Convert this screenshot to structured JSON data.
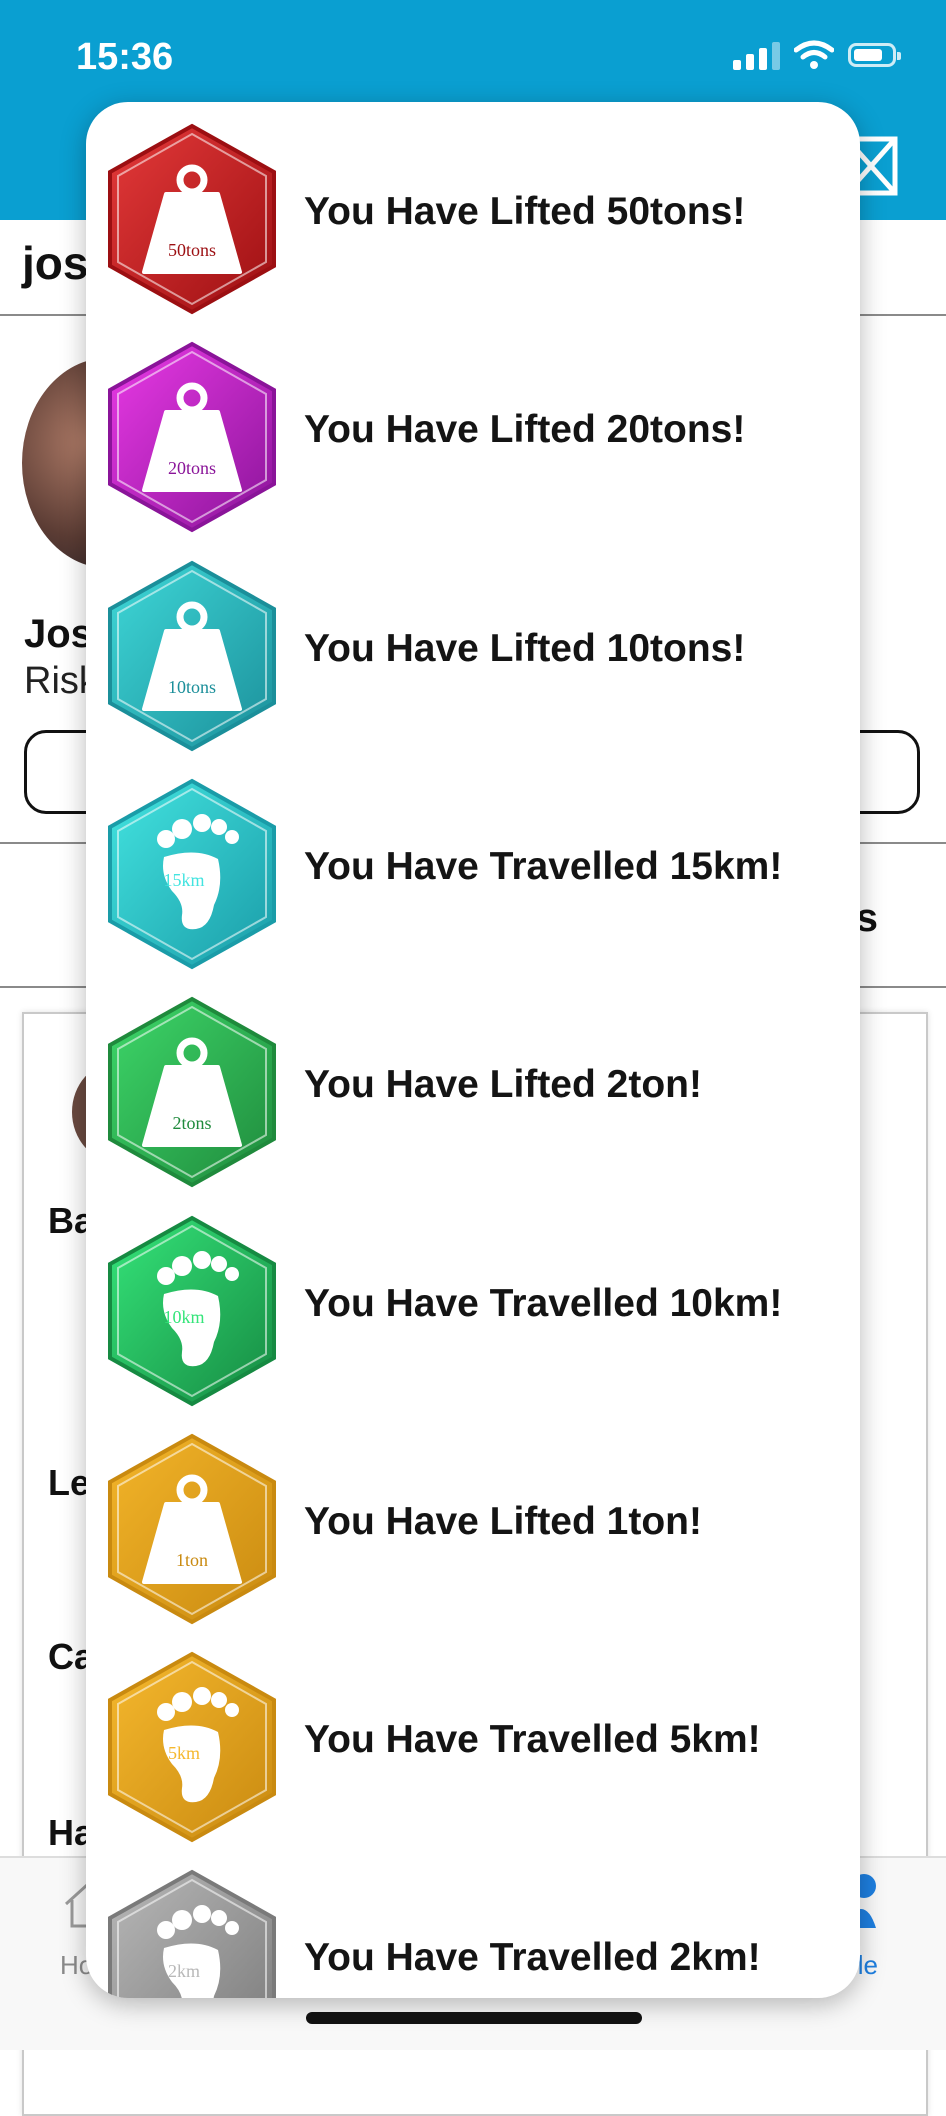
{
  "status_bar": {
    "time": "15:36"
  },
  "profile": {
    "username_fragment": "jos",
    "name_fragment": "Jos",
    "subtitle_fragment": "Risk",
    "tab_fragment": "s",
    "card_labels": [
      "Ba",
      "Le",
      "Ca",
      "Ha"
    ]
  },
  "tab_bar": {
    "home_label_fragment": "Ho",
    "profile_label_fragment": "ile",
    "active_color": "#1e7fe0"
  },
  "colors": {
    "header": "#0a9fd1"
  },
  "badges": [
    {
      "kind": "weight",
      "badge_text": "50tons",
      "label": "You Have Lifted 50tons!",
      "color_light": "#e53a3a",
      "color_dark": "#9c0f12"
    },
    {
      "kind": "weight",
      "badge_text": "20tons",
      "label": "You Have Lifted 20tons!",
      "color_light": "#ea3ae6",
      "color_dark": "#8a1499"
    },
    {
      "kind": "weight",
      "badge_text": "10tons",
      "label": "You Have Lifted 10tons!",
      "color_light": "#3fd8d8",
      "color_dark": "#1b8f9a"
    },
    {
      "kind": "foot",
      "badge_text": "15km",
      "label": "You Have Travelled 15km!",
      "color_light": "#43e4e0",
      "color_dark": "#1a9ca8"
    },
    {
      "kind": "weight",
      "badge_text": "2tons",
      "label": "You Have Lifted 2ton!",
      "color_light": "#3ed86a",
      "color_dark": "#1f8a3c"
    },
    {
      "kind": "foot",
      "badge_text": "10km",
      "label": "You Have Travelled 10km!",
      "color_light": "#35e57a",
      "color_dark": "#168a42"
    },
    {
      "kind": "weight",
      "badge_text": "1ton",
      "label": "You Have Lifted 1ton!",
      "color_light": "#f3b52a",
      "color_dark": "#c98a10"
    },
    {
      "kind": "foot",
      "badge_text": "5km",
      "label": "You Have Travelled 5km!",
      "color_light": "#f5b82e",
      "color_dark": "#c98a10"
    },
    {
      "kind": "foot",
      "badge_text": "2km",
      "label": "You Have Travelled 2km!",
      "color_light": "#b8b8b8",
      "color_dark": "#7a7a7a"
    }
  ]
}
